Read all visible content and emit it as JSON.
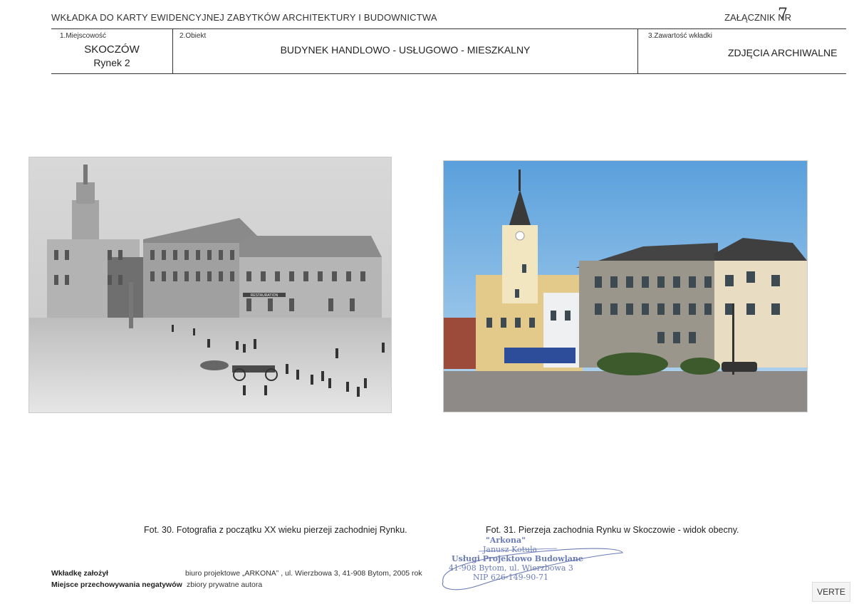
{
  "header": {
    "title": "WKŁADKA DO KARTY EWIDENCYJNEJ ZABYTKÓW ARCHITEKTURY I BUDOWNICTWA",
    "annex_label": "ZAŁĄCZNIK NR",
    "annex_number": "7"
  },
  "fields": {
    "place_label": "1.Miejscowość",
    "place_city": "SKOCZÓW",
    "place_address": "Rynek 2",
    "object_label": "2.Obiekt",
    "object_value": "BUDYNEK HANDLOWO - USŁUGOWO - MIESZKALNY",
    "content_label": "3.Zawartość wkładki",
    "content_value": "ZDJĘCIA ARCHIWALNE"
  },
  "photos": [
    {
      "caption": "Fot. 30. Fotografia z początku XX wieku pierzeji zachodniej Rynku.",
      "shop_sign": "RESTAURATION"
    },
    {
      "caption": "Fot. 31. Pierzeja zachodnia Rynku w Skoczowie - widok obecny.",
      "shop_sign": ""
    }
  ],
  "footer": {
    "founder_label": "Wkładkę założył",
    "founder_value": "biuro projektowe „ARKONA” , ul. Wierzbowa 3, 41-908 Bytom, 2005 rok",
    "storage_label": "Miejsce przechowywania negatywów",
    "storage_value": "zbiory prywatne autora"
  },
  "stamp": {
    "line1": "\"Arkona\"",
    "line2": "Janusz Kotula",
    "line3": "Usługi Projektowo Budowlane",
    "line4": "41-908 Bytom, ul. Wierzbowa 3",
    "line5": "NIP 626-149-90-71"
  },
  "verte": "VERTE",
  "colors": {
    "rule": "#333333",
    "stamp_ink": "#6a7bb8",
    "sky": "#6aa8e0"
  }
}
